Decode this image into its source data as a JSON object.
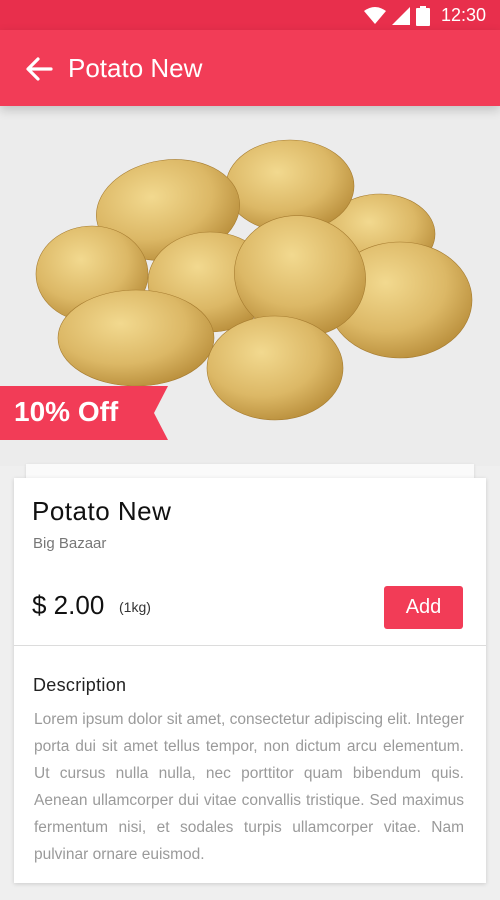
{
  "status_bar": {
    "time": "12:30",
    "icons": [
      "wifi-icon",
      "signal-icon",
      "battery-icon"
    ]
  },
  "app_bar": {
    "back_icon": "arrow-left-icon",
    "title": "Potato New"
  },
  "hero": {
    "image": "potatoes",
    "discount_label": "10% Off"
  },
  "product": {
    "name": "Potato New",
    "store": "Big Bazaar",
    "price": "$ 2.00",
    "unit": "(1kg)",
    "add_label": "Add"
  },
  "description": {
    "title": "Description",
    "text": "Lorem ipsum dolor sit amet, consectetur adipiscing elit. Integer porta dui sit amet tellus tempor, non dictum arcu elementum. Ut cursus nulla nulla, nec porttitor quam bibendum quis. Aenean ullamcorper dui vitae convallis tristique. Sed maximus fermentum nisi, et sodales turpis ullamcorper vitae. Nam pulvinar ornare euismod."
  },
  "colors": {
    "accent": "#f23c57",
    "status_bar": "#e82f4c",
    "potato": "#d9b562"
  }
}
